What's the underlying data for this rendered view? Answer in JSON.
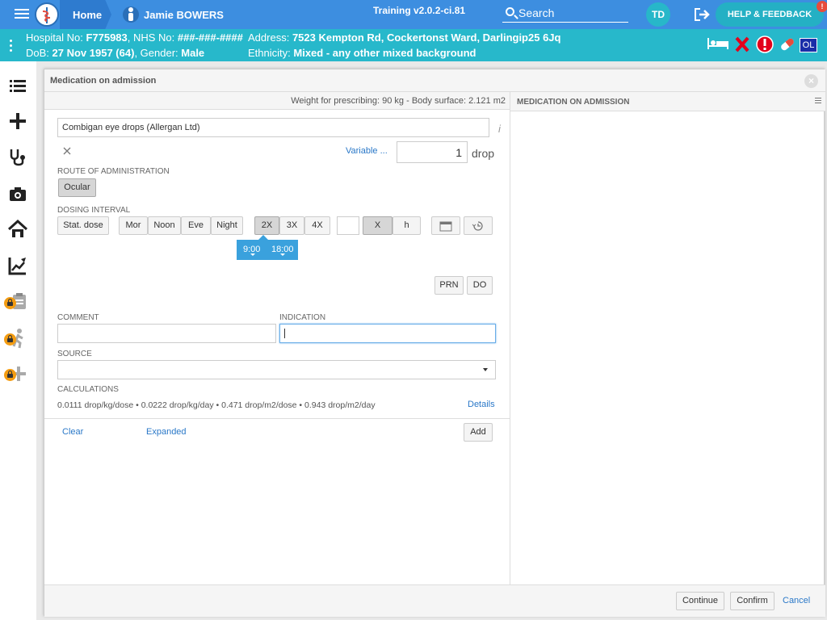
{
  "topbar": {
    "home": "Home",
    "patient_name": "Jamie BOWERS",
    "training": "Training v2.0.2-ci.81",
    "search": "Search",
    "user_initials": "TD",
    "help": "HELP & FEEDBACK",
    "help_badge": "!"
  },
  "banner": {
    "hospital_label": "Hospital No:",
    "hospital_no": "F775983",
    "nhs_label": ", NHS No:",
    "nhs_no": "###-###-####",
    "dob_label": "DoB:",
    "dob": "27 Nov 1957 (64)",
    "gender_label": ", Gender:",
    "gender": "Male",
    "address_label": "Address:",
    "address": "7523 Kempton Rd, Cockertonst Ward, Darlingip25 6Jq",
    "ethnicity_label": "Ethnicity:",
    "ethnicity": "Mixed - any other mixed background",
    "icons": [
      "bed-icon",
      "x-icon",
      "alert-icon",
      "pill-icon",
      "ol-icon"
    ],
    "ol": "OL"
  },
  "leftnav": {
    "items": [
      "list-icon",
      "plus-icon",
      "stethoscope-icon",
      "camera-icon",
      "home-icon",
      "chart-edit-icon",
      "clipboard-lock-icon",
      "walking-lock-icon",
      "plus-lock-icon"
    ]
  },
  "modal": {
    "title": "Medication on admission",
    "weight": "Weight for prescribing: 90 kg - Body surface: 2.121 m2",
    "right_title": "MEDICATION ON ADMISSION",
    "drug": "Combigan eye drops (Allergan Ltd)",
    "variable": "Variable ...",
    "dose_value": "1",
    "dose_unit": "drop",
    "route_label": "ROUTE OF ADMINISTRATION",
    "route": "Ocular",
    "interval_label": "DOSING INTERVAL",
    "stat": "Stat. dose",
    "times": [
      "Mor",
      "Noon",
      "Eve",
      "Night"
    ],
    "freq": [
      "2X",
      "3X",
      "4X"
    ],
    "x_label": "X",
    "h_label": "h",
    "tooltip_times": [
      "9:00",
      "18:00"
    ],
    "prn": "PRN",
    "do": "DO",
    "comment_label": "COMMENT",
    "indication_label": "INDICATION",
    "source_label": "SOURCE",
    "calc_label": "CALCULATIONS",
    "calc": "0.0111 drop/kg/dose • 0.0222 drop/kg/day • 0.471 drop/m2/dose • 0.943 drop/m2/day",
    "details": "Details",
    "clear": "Clear",
    "expanded": "Expanded",
    "add": "Add",
    "continue": "Continue",
    "confirm": "Confirm",
    "cancel": "Cancel"
  },
  "colors": {
    "topbar": "#3d8ee0",
    "banner": "#27b8cb",
    "accent": "#2a78c8"
  }
}
